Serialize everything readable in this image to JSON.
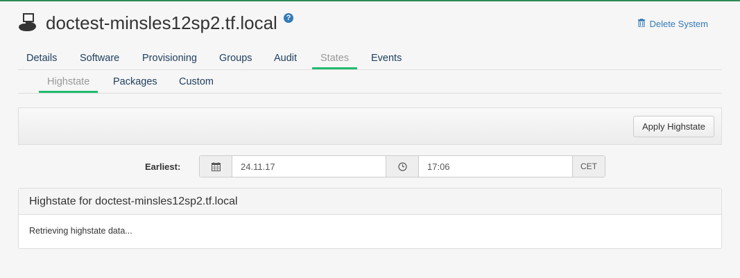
{
  "header": {
    "system_name": "doctest-minsles12sp2.tf.local",
    "help_icon": "question-circle-icon",
    "system_icon": "salt-minion-system-icon",
    "delete_label": "Delete System",
    "delete_icon": "trash-icon"
  },
  "tabs": [
    {
      "label": "Details",
      "active": false
    },
    {
      "label": "Software",
      "active": false
    },
    {
      "label": "Provisioning",
      "active": false
    },
    {
      "label": "Groups",
      "active": false
    },
    {
      "label": "Audit",
      "active": false
    },
    {
      "label": "States",
      "active": true
    },
    {
      "label": "Events",
      "active": false
    }
  ],
  "subtabs": [
    {
      "label": "Highstate",
      "active": true
    },
    {
      "label": "Packages",
      "active": false
    },
    {
      "label": "Custom",
      "active": false
    }
  ],
  "toolbar": {
    "apply_label": "Apply Highstate"
  },
  "schedule": {
    "earliest_label": "Earliest:",
    "date_value": "24.11.17",
    "time_value": "17:06",
    "timezone": "CET",
    "calendar_icon": "calendar-icon",
    "clock_icon": "clock-icon"
  },
  "highstate_panel": {
    "title": "Highstate for doctest-minsles12sp2.tf.local",
    "status": "Retrieving highstate data..."
  },
  "colors": {
    "active_tab_underline": "#21bb6f",
    "link": "#337ab7",
    "top_border": "#2d8a54"
  }
}
